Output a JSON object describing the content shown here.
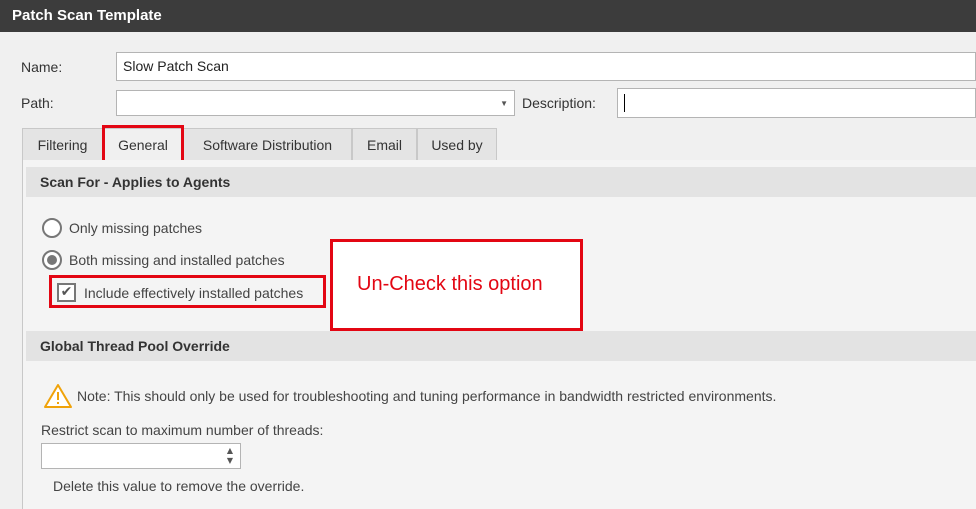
{
  "window": {
    "title": "Patch Scan Template"
  },
  "form": {
    "name_label": "Name:",
    "name_value": "Slow Patch Scan",
    "path_label": "Path:",
    "path_value": "",
    "description_label": "Description:",
    "description_value": ""
  },
  "tabs": [
    {
      "label": "Filtering"
    },
    {
      "label": "General",
      "active": true
    },
    {
      "label": "Software Distribution"
    },
    {
      "label": "Email"
    },
    {
      "label": "Used by"
    }
  ],
  "scan_for": {
    "header": "Scan For - Applies to Agents",
    "options": [
      {
        "label": "Only missing patches",
        "selected": false
      },
      {
        "label": "Both missing and installed patches",
        "selected": true
      }
    ],
    "include_label": "Include effectively installed patches",
    "include_checked": true
  },
  "annotation": {
    "text": "Un-Check this option",
    "color": "#e30613"
  },
  "thread_pool": {
    "header": "Global Thread Pool Override",
    "note": "Note: This should only be used for troubleshooting and tuning performance in bandwidth restricted environments.",
    "restrict_label": "Restrict scan to maximum number of threads:",
    "threads_value": "",
    "hint": "Delete this value to remove the override."
  },
  "colors": {
    "titlebar": "#3c3c3c",
    "highlight": "#e30613",
    "warning": "#f0a30a"
  }
}
